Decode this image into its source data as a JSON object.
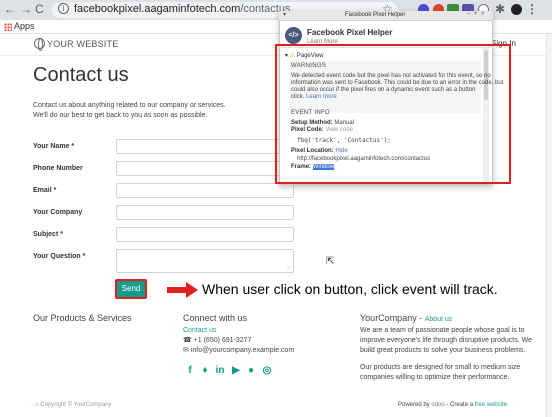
{
  "browser": {
    "url_host": "facebookpixel.aagaminfotech.com",
    "url_path": "/contactus",
    "bookmarks_label": "Apps"
  },
  "site": {
    "logo_text": "YOUR WEBSITE",
    "signin_label": "Sign In",
    "page_title": "Contact us",
    "intro_line1": "Contact us about anything related to our company or services.",
    "intro_line2": "We'll do our best to get back to you as soon as possible.",
    "form": {
      "name_label": "Your Name *",
      "phone_label": "Phone Number",
      "email_label": "Email *",
      "company_label": "Your Company",
      "subject_label": "Subject *",
      "question_label": "Your Question *",
      "send_label": "Send"
    },
    "annotation": "When user click on button, click event will track."
  },
  "footer": {
    "products_title": "Our Products & Services",
    "connect_title": "Connect with us",
    "connect_link": "Contact us",
    "phone": "+1 (650) 691-3277",
    "email": "info@yourcompany.example.com",
    "about_title": "YourCompany - ",
    "about_link": "About us",
    "about_p1_l1": "We are a team of passionate people whose goal is to",
    "about_p1_l2": "improve everyone's life through disruptive products. We",
    "about_p1_l3": "build great products to solve your business problems.",
    "about_p2_l1": "Our products are designed for small to medium size",
    "about_p2_l2": "companies willing to optimize their performance.",
    "copyright": "Copyright © YourCompany",
    "powered_prefix": "Powered by",
    "powered_brand": "odoo",
    "powered_mid": "- Create a",
    "powered_link": "free website"
  },
  "social_icons": [
    "facebook-icon",
    "twitter-icon",
    "linkedin-icon",
    "youtube-icon",
    "github-icon",
    "instagram-icon"
  ],
  "pixel_helper": {
    "window_title": "Facebook Pixel Helper",
    "name": "Facebook Pixel Helper",
    "learn_more": "Learn More",
    "event_name": "PageView",
    "warnings_title": "WARNINGS",
    "warn_l1": "We detected event code but the pixel has not activated for this event, so no",
    "warn_l2": "information was sent to Facebook. This could be due to an error in the code, but",
    "warn_l3": "could also occur if the pixel fires on a dynamic event such as a button",
    "warn_l4": "click.",
    "warn_link": "Learn more",
    "event_info_title": "EVENT INFO",
    "setup_label": "Setup Method:",
    "setup_value": "Manual",
    "pixel_code_label": "Pixel Code:",
    "pixel_code_value": "View code",
    "code_snippet": "fbq('track', 'Contactus');",
    "pixel_location_label": "Pixel Location:",
    "pixel_location_link": "Hide",
    "pixel_location_url": "http://facebookpixel.aagaminfotech.com/contactus",
    "frame_label": "Frame:",
    "frame_value": "Window"
  },
  "colors": {
    "accent": "#169c8c",
    "annotation_red": "#e02020",
    "fb_blue": "#4a5a7c"
  }
}
